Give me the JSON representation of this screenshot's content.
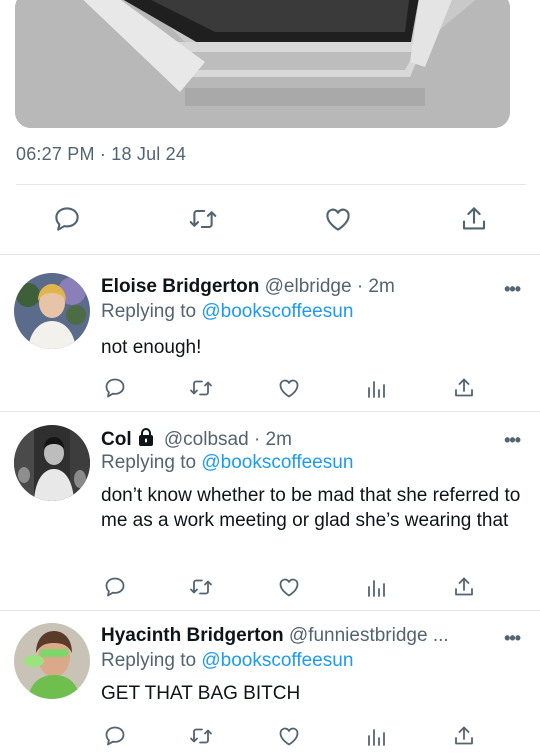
{
  "tweet": {
    "timestamp": "06:27 PM · 18 Jul 24"
  },
  "icons": {
    "reply": "speech-bubble-icon",
    "retweet": "retweet-icon",
    "like": "heart-icon",
    "views": "bar-chart-icon",
    "share": "share-upload-icon",
    "more": "more-dots-icon",
    "lock": "lock-icon"
  },
  "colors": {
    "link": "#1d9bf0",
    "secondary_text": "#536471",
    "divider": "#e6e6e6"
  },
  "replies": [
    {
      "name": "Eloise Bridgerton",
      "handle": "@elbridge",
      "time": "· 2m",
      "replying_prefix": "Replying to ",
      "replying_to": "@bookscoffeesun",
      "text": "not enough!",
      "more": "•••"
    },
    {
      "name": "Col",
      "handle": "@colbsad",
      "time": "· 2m",
      "replying_prefix": "Replying to ",
      "replying_to": "@bookscoffeesun",
      "text": "don’t know whether to be mad that she referred to me as a work meeting or glad she’s wearing that",
      "more": "•••"
    },
    {
      "name": "Hyacinth Bridgerton",
      "handle": "@funniestbridge ...",
      "time": "",
      "replying_prefix": "Replying to ",
      "replying_to": "@bookscoffeesun",
      "text": "GET THAT BAG BITCH",
      "more": "•••"
    }
  ]
}
